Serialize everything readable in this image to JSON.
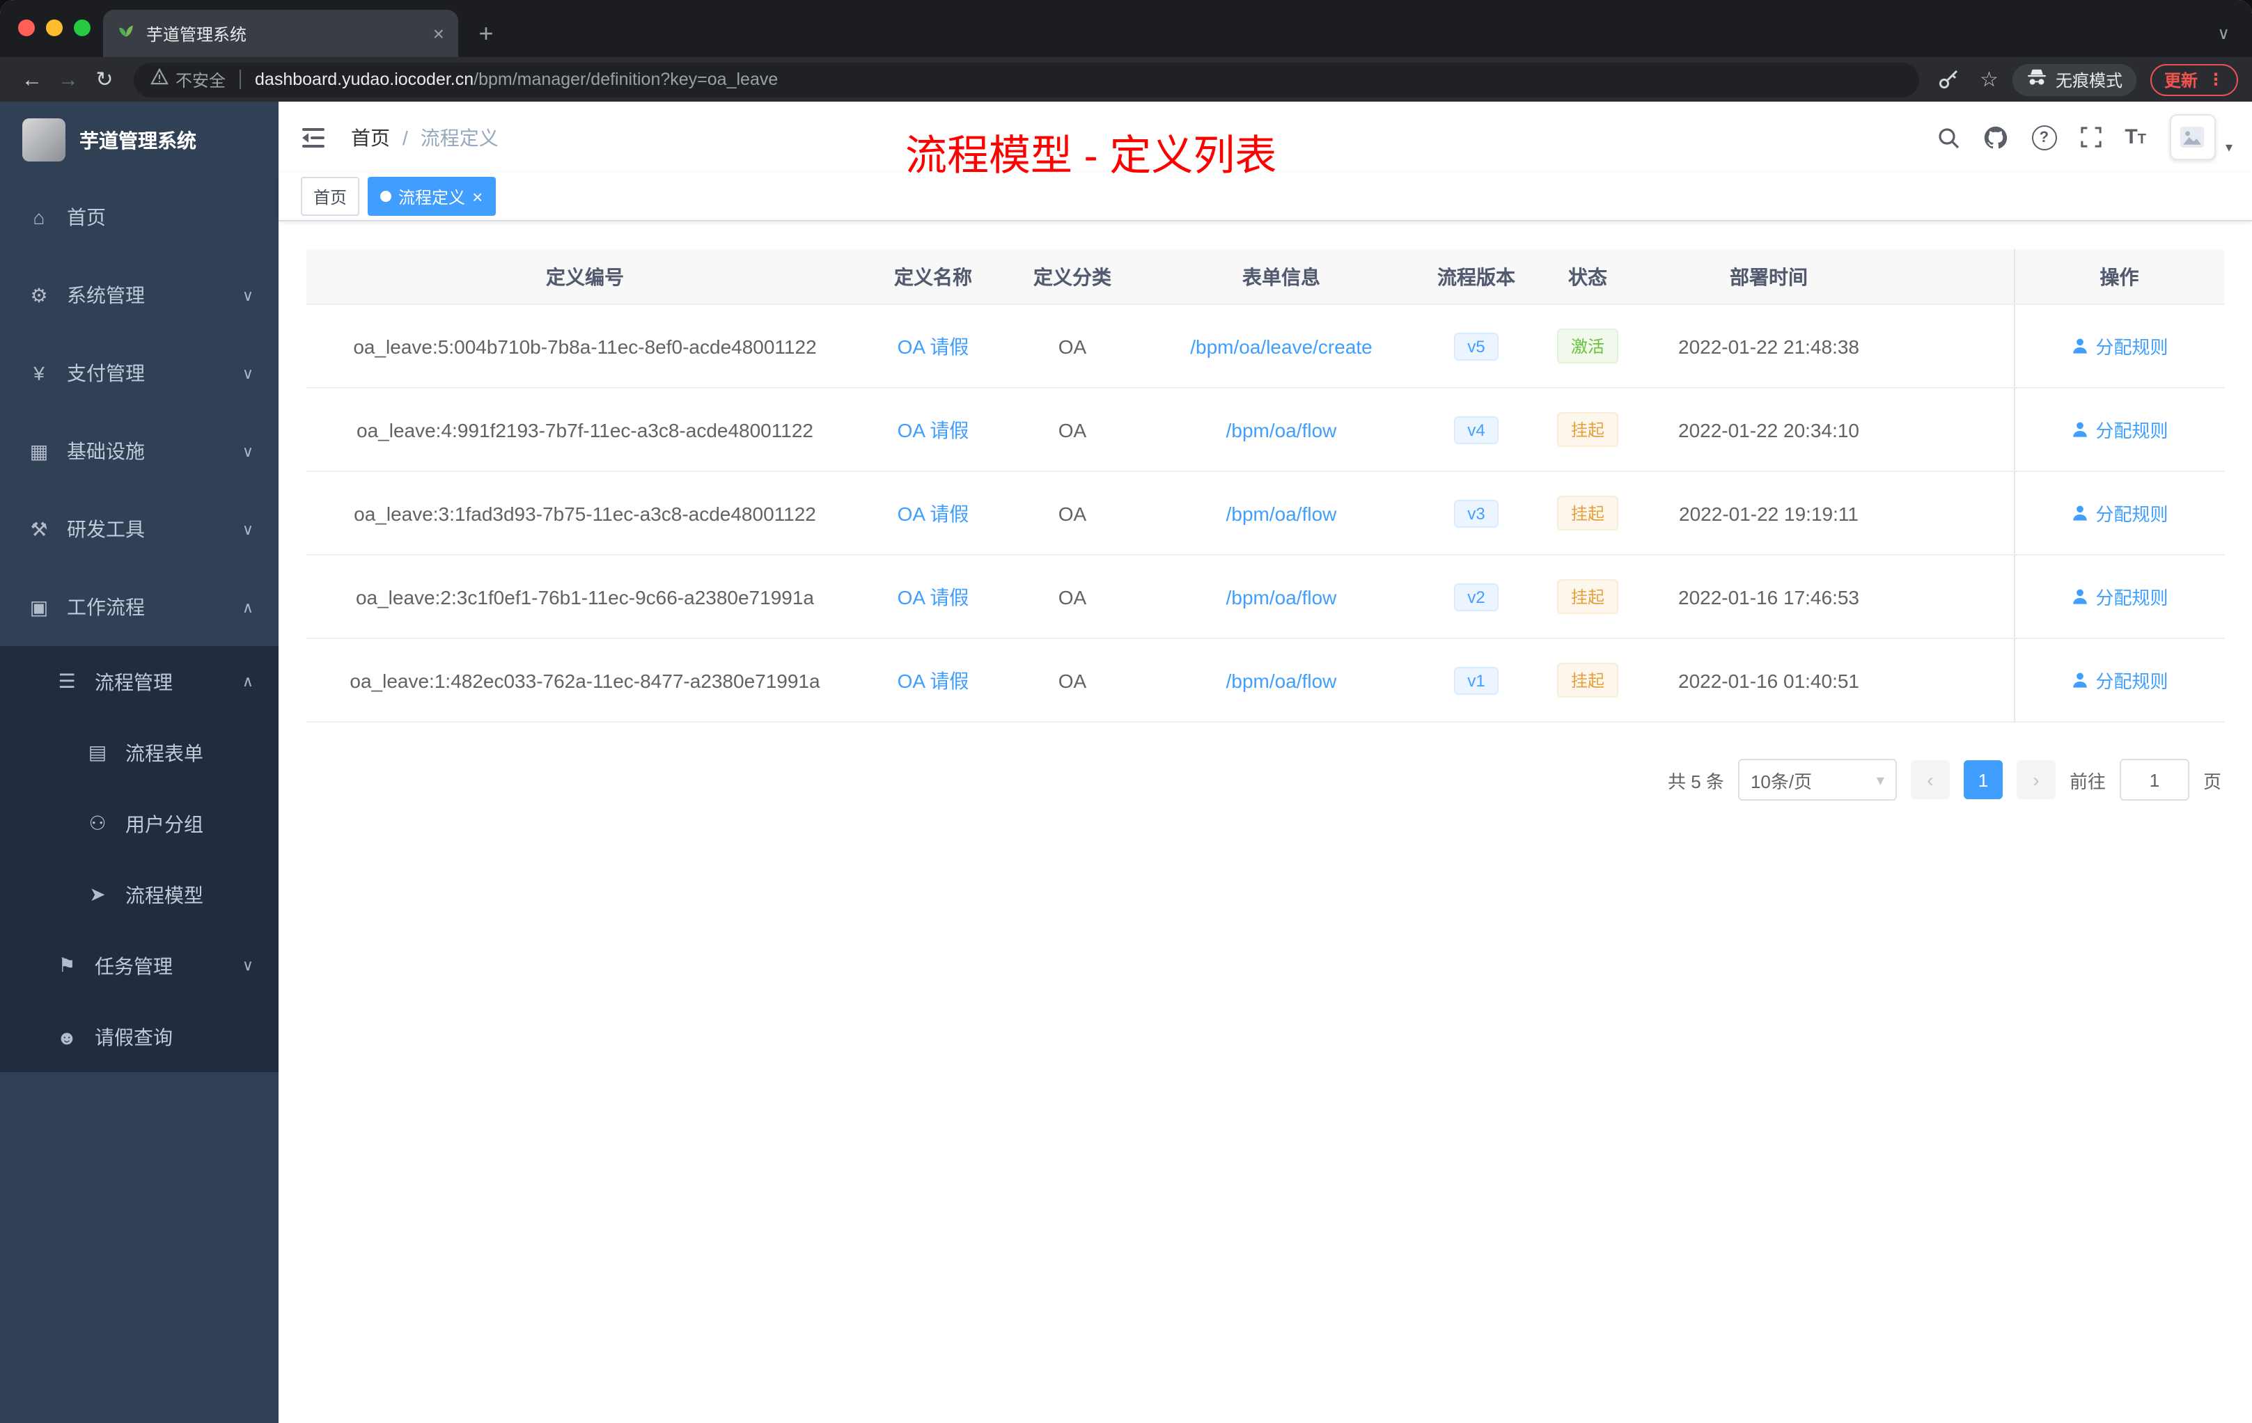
{
  "browser": {
    "tab_title": "芋道管理系统",
    "security_label": "不安全",
    "url_domain": "dashboard.yudao.iocoder.cn",
    "url_path": "/bpm/manager/definition?key=oa_leave",
    "incognito_label": "无痕模式",
    "update_label": "更新"
  },
  "sidebar": {
    "logo_title": "芋道管理系统",
    "items": [
      {
        "label": "首页",
        "icon": "home",
        "level": 0,
        "chevron": null
      },
      {
        "label": "系统管理",
        "icon": "gear",
        "level": 0,
        "chevron": "down"
      },
      {
        "label": "支付管理",
        "icon": "yen",
        "level": 0,
        "chevron": "down"
      },
      {
        "label": "基础设施",
        "icon": "infra",
        "level": 0,
        "chevron": "down"
      },
      {
        "label": "研发工具",
        "icon": "tools",
        "level": 0,
        "chevron": "down"
      },
      {
        "label": "工作流程",
        "icon": "workflow",
        "level": 0,
        "chevron": "up"
      },
      {
        "label": "流程管理",
        "icon": "process",
        "level": 1,
        "chevron": "up"
      },
      {
        "label": "流程表单",
        "icon": "form",
        "level": 2,
        "chevron": null
      },
      {
        "label": "用户分组",
        "icon": "group",
        "level": 2,
        "chevron": null
      },
      {
        "label": "流程模型",
        "icon": "model",
        "level": 2,
        "chevron": null
      },
      {
        "label": "任务管理",
        "icon": "task",
        "level": 1,
        "chevron": "down"
      },
      {
        "label": "请假查询",
        "icon": "person",
        "level": 1,
        "chevron": null
      }
    ]
  },
  "header": {
    "breadcrumb_home": "首页",
    "breadcrumb_sep": "/",
    "breadcrumb_current": "流程定义"
  },
  "annotation": {
    "title": "流程模型 - 定义列表"
  },
  "tags": [
    {
      "label": "首页",
      "active": false
    },
    {
      "label": "流程定义",
      "active": true
    }
  ],
  "table": {
    "columns": [
      "定义编号",
      "定义名称",
      "定义分类",
      "表单信息",
      "流程版本",
      "状态",
      "部署时间",
      "操作"
    ],
    "rows": [
      {
        "id": "oa_leave:5:004b710b-7b8a-11ec-8ef0-acde48001122",
        "name": "OA 请假",
        "category": "OA",
        "form": "/bpm/oa/leave/create",
        "version": "v5",
        "status": "激活",
        "status_type": "success",
        "deploy_time": "2022-01-22 21:48:38",
        "action": "分配规则"
      },
      {
        "id": "oa_leave:4:991f2193-7b7f-11ec-a3c8-acde48001122",
        "name": "OA 请假",
        "category": "OA",
        "form": "/bpm/oa/flow",
        "version": "v4",
        "status": "挂起",
        "status_type": "warning",
        "deploy_time": "2022-01-22 20:34:10",
        "action": "分配规则"
      },
      {
        "id": "oa_leave:3:1fad3d93-7b75-11ec-a3c8-acde48001122",
        "name": "OA 请假",
        "category": "OA",
        "form": "/bpm/oa/flow",
        "version": "v3",
        "status": "挂起",
        "status_type": "warning",
        "deploy_time": "2022-01-22 19:19:11",
        "action": "分配规则"
      },
      {
        "id": "oa_leave:2:3c1f0ef1-76b1-11ec-9c66-a2380e71991a",
        "name": "OA 请假",
        "category": "OA",
        "form": "/bpm/oa/flow",
        "version": "v2",
        "status": "挂起",
        "status_type": "warning",
        "deploy_time": "2022-01-16 17:46:53",
        "action": "分配规则"
      },
      {
        "id": "oa_leave:1:482ec033-762a-11ec-8477-a2380e71991a",
        "name": "OA 请假",
        "category": "OA",
        "form": "/bpm/oa/flow",
        "version": "v1",
        "status": "挂起",
        "status_type": "warning",
        "deploy_time": "2022-01-16 01:40:51",
        "action": "分配规则"
      }
    ]
  },
  "pagination": {
    "total": "共 5 条",
    "page_size": "10条/页",
    "page": "1",
    "goto_label": "前往",
    "goto_value": "1",
    "unit": "页"
  },
  "icons": {
    "home": "⌂",
    "gear": "⚙",
    "yen": "¥",
    "infra": "▦",
    "tools": "⚒",
    "workflow": "▣",
    "process": "☰",
    "form": "▤",
    "group": "⚇",
    "model": "➤",
    "task": "⚑",
    "person": "☻",
    "chevron_down": "∨",
    "chevron_up": "∧",
    "back": "←",
    "forward": "→",
    "reload": "↻",
    "star": "☆",
    "dots": "⋮",
    "plus": "+",
    "tab_chevron": "∨",
    "caret": "▾",
    "question": "?",
    "font_big": "T",
    "font_small": "T",
    "select_caret": "▾",
    "prev": "‹",
    "next": "›",
    "close": "×"
  },
  "colors": {
    "accent": "#409eff",
    "success": "#67c23a",
    "warning": "#e6a23c",
    "annotation": "#ff0000",
    "sidebar_bg": "#304156"
  }
}
